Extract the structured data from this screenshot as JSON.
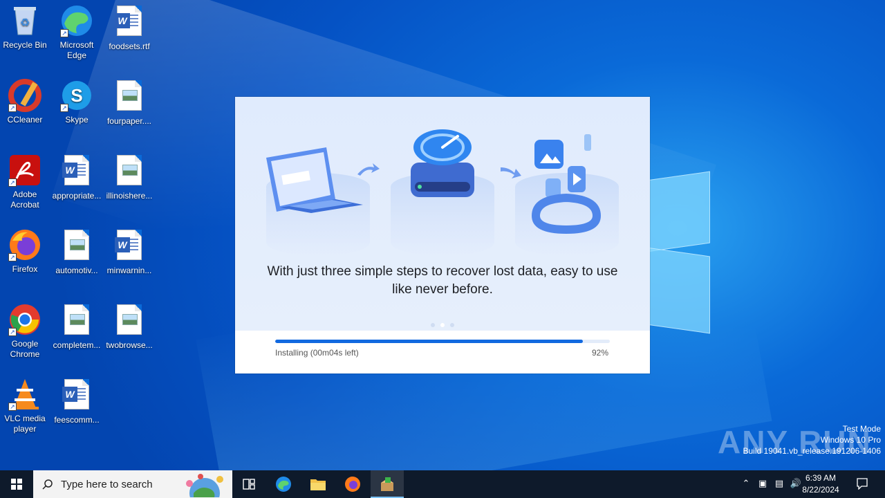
{
  "desktop": {
    "icons": [
      {
        "label": "Recycle Bin",
        "icon": "recycle-bin-icon"
      },
      {
        "label": "Microsoft Edge",
        "icon": "edge-icon"
      },
      {
        "label": "foodsets.rtf",
        "icon": "word-doc-icon"
      },
      {
        "label": "CCleaner",
        "icon": "ccleaner-icon"
      },
      {
        "label": "Skype",
        "icon": "skype-icon"
      },
      {
        "label": "fourpaper....",
        "icon": "image-file-icon"
      },
      {
        "label": "Adobe Acrobat",
        "icon": "acrobat-icon"
      },
      {
        "label": "appropriate...",
        "icon": "word-doc-icon"
      },
      {
        "label": "illinoishere...",
        "icon": "image-file-icon"
      },
      {
        "label": "Firefox",
        "icon": "firefox-icon"
      },
      {
        "label": "automotiv...",
        "icon": "image-file-icon"
      },
      {
        "label": "minwarnin...",
        "icon": "word-doc-icon"
      },
      {
        "label": "Google Chrome",
        "icon": "chrome-icon"
      },
      {
        "label": "completem...",
        "icon": "image-file-icon"
      },
      {
        "label": "twobrowse...",
        "icon": "image-file-icon"
      },
      {
        "label": "VLC media player",
        "icon": "vlc-icon"
      },
      {
        "label": "feescomm...",
        "icon": "word-doc-icon"
      }
    ]
  },
  "installer": {
    "caption": "With just three simple steps to recover lost data, easy to use like never before.",
    "slide_index": 1,
    "slide_count": 3,
    "status": "Installing (00m04s left)",
    "percent_label": "92%",
    "progress": 0.92,
    "accent": "#1269e0"
  },
  "watermark": {
    "brand": "ANY RUN",
    "line1": "Test Mode",
    "line2": "Windows 10 Pro",
    "line3": "Build 19041.vb_release.191206-1406"
  },
  "taskbar": {
    "search_placeholder": "Type here to search",
    "time": "6:39 AM",
    "date": "8/22/2024"
  }
}
